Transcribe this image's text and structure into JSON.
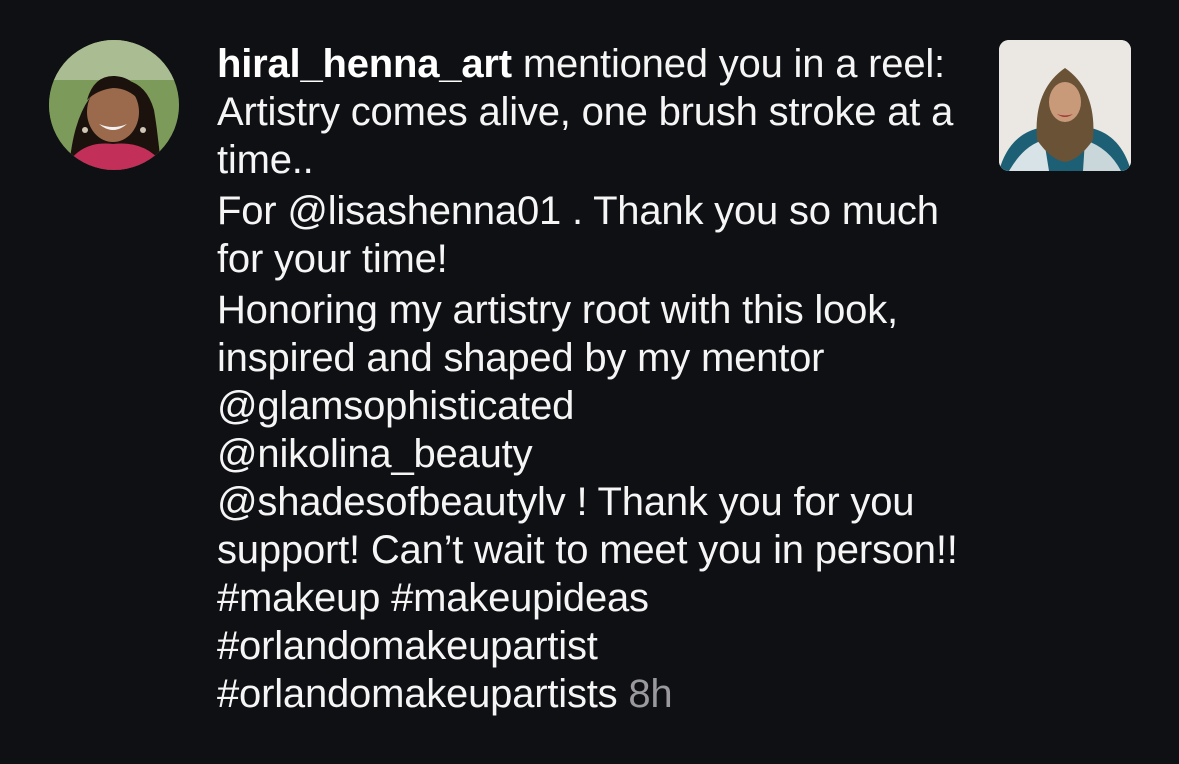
{
  "notification": {
    "username": "hiral_henna_art",
    "action": "mentioned you in a reel: Artistry comes alive, one brush stroke at a time..",
    "line2": "For @lisashenna01 . Thank you so much for your time!",
    "line3_part1": "Honoring my artistry root with this look, inspired and shaped by my mentor @glamsophisticated",
    "line3_part2": "@nikolina_beauty",
    "line3_part3": "@shadesofbeautylv ! Thank you for you support! Can’t wait to meet you in person!! #makeup #makeupideas",
    "line3_part4": "#orlandomakeupartist",
    "line3_part5": "#orlandomakeupartists",
    "time": "8h"
  },
  "colors": {
    "background": "#0f1014",
    "text": "#f5f5f5",
    "time": "#9a9a9e"
  },
  "icons": {
    "avatar": "user-avatar-photo",
    "thumbnail": "reel-thumbnail-photo"
  }
}
